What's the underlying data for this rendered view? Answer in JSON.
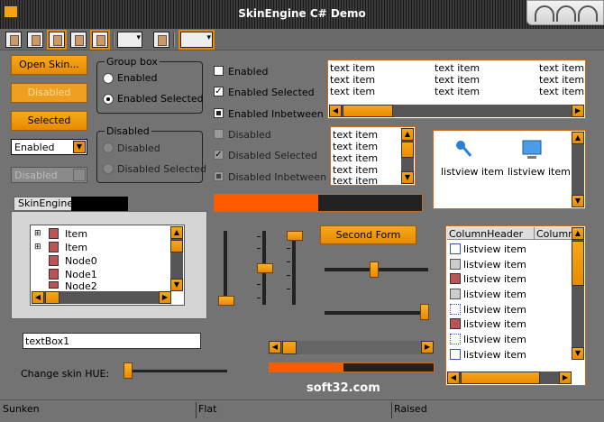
{
  "window": {
    "title": "SkinEngine C# Demo",
    "accent": "#f29a10"
  },
  "toolbar": {
    "icons": [
      "book-icon",
      "book-icon",
      "book-icon",
      "book-icon",
      "book-icon",
      "book-icon",
      "book-icon",
      "book-icon"
    ]
  },
  "buttons": {
    "open_skin": "Open Skin...",
    "disabled": "Disabled",
    "selected": "Selected",
    "second_form": "Second Form"
  },
  "combos": {
    "enabled": "Enabled",
    "disabled": "Disabled"
  },
  "groupbox": {
    "title": "Group box",
    "radio1": "Enabled",
    "radio2": "Enabled Selected"
  },
  "disabled_group": {
    "title": "Disabled",
    "radio1": "Disabled",
    "radio2": "Disabled Selected"
  },
  "checkboxes": [
    "Enabled",
    "Enabled Selected",
    "Enabled Inbetween",
    "Disabled",
    "Disabled Selected",
    "Disabled Inbetween"
  ],
  "listbox_multi": {
    "rows": [
      [
        "text item",
        "text item",
        "text item"
      ],
      [
        "text item",
        "text item",
        "text item"
      ],
      [
        "text item",
        "text item",
        "text item"
      ]
    ]
  },
  "listbox_small": {
    "items": [
      "text item",
      "text item",
      "text item",
      "text item",
      "text item"
    ]
  },
  "listview_icons": {
    "items": [
      "listview item",
      "listview item"
    ]
  },
  "listview_details": {
    "headers": [
      "ColumnHeader",
      "Column"
    ],
    "items": [
      "listview item",
      "listview item",
      "listview item",
      "listview item",
      "listview item",
      "listview item",
      "listview item",
      "listview item"
    ]
  },
  "tab": {
    "label": "SkinEngine"
  },
  "tree": {
    "items": [
      "Item",
      "Item",
      "Node0",
      "Node1",
      "Node2"
    ]
  },
  "progress": {
    "top_value": 0.5,
    "bottom_value": 0.45
  },
  "textbox": {
    "value": "textBox1"
  },
  "hue": {
    "label": "Change skin HUE:"
  },
  "status": {
    "left": "Sunken",
    "mid": "Flat",
    "right": "Raised"
  },
  "watermark": "soft32.com"
}
